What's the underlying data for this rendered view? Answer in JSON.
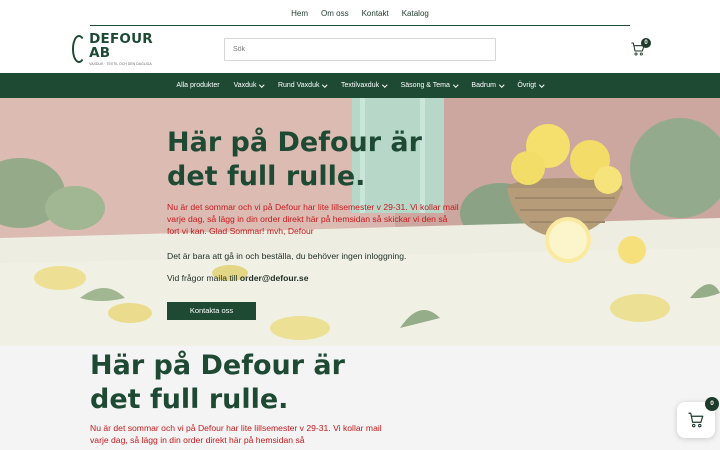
{
  "top_links": [
    "Hem",
    "Om oss",
    "Kontakt",
    "Katalog"
  ],
  "logo": {
    "name": "DEFOUR AB",
    "tagline": "VAXDUK · TEXTIL OCH DEN DAGLIGA"
  },
  "search": {
    "placeholder": "Sök"
  },
  "cart": {
    "count": "0"
  },
  "main_nav": [
    "Alla produkter",
    "Vaxduk",
    "Rund Vaxduk",
    "Textilvaxduk",
    "Säsong & Tema",
    "Badrum",
    "Övrigt"
  ],
  "hero": {
    "title": "Här på Defour är det full rulle.",
    "notice": "Nu är det sommar och vi på Defour har lite lillsemester v 29-31.  Vi kollar mail varje dag, så lägg in din order direkt här på hemsidan så skickar vi den så fort vi kan.   Glad Sommar! mvh, Defour",
    "line1": "Det är bara att gå in och beställa, du behöver ingen inloggning.",
    "line2_prefix": "Vid frågor maila till ",
    "line2_email": "order@defour.se",
    "button": "Kontakta oss"
  },
  "section": {
    "title": "Här på Defour är det full rulle.",
    "notice": "Nu är det sommar och vi på Defour har lite lillsemester v 29-31.  Vi kollar mail varje dag, så lägg in din order direkt här på hemsidan så"
  },
  "floating_cart": {
    "count": "0"
  }
}
